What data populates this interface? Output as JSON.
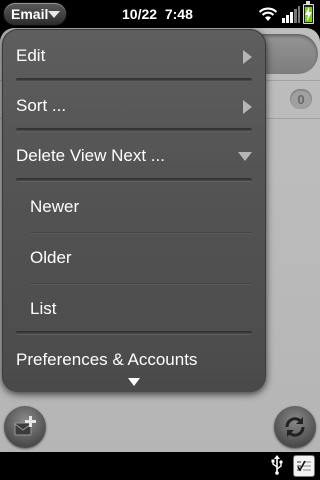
{
  "status_bar": {
    "app_name": "Email",
    "date": "10/22",
    "time": "7:48"
  },
  "inbox": {
    "unread_count": "0"
  },
  "menu": {
    "items": [
      {
        "label": "Edit",
        "kind": "submenu"
      },
      {
        "label": "Sort ...",
        "kind": "submenu"
      },
      {
        "label": "Delete View Next ...",
        "kind": "expanded"
      }
    ],
    "subitems": [
      {
        "label": "Newer"
      },
      {
        "label": "Older"
      },
      {
        "label": "List"
      }
    ],
    "last_item": {
      "label": "Preferences & Accounts"
    }
  },
  "icons": {
    "app_menu_caret": "chevron-down-icon",
    "wifi": "wifi-icon",
    "signal": "signal-bars-icon",
    "battery": "battery-charging-icon",
    "compose": "compose-mail-icon",
    "sync": "sync-icon",
    "usb": "usb-icon",
    "notification": "notification-icon"
  },
  "colors": {
    "battery_fill": "#7fcf27",
    "menu_background": "#545454"
  },
  "battery_level": 0.85
}
